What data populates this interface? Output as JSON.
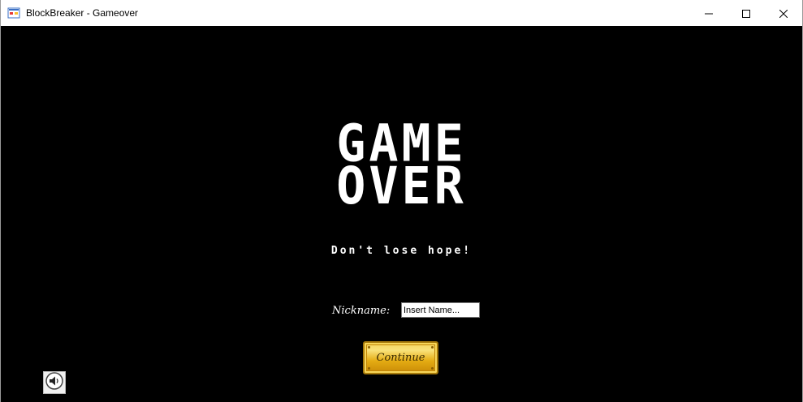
{
  "window": {
    "title": "BlockBreaker - Gameover",
    "icon": "app-icon",
    "controls": {
      "minimize_icon": "minimize-icon",
      "maximize_icon": "maximize-icon",
      "close_icon": "close-icon"
    }
  },
  "screen": {
    "heading_line1": "GAME",
    "heading_line2": "OVER",
    "subtitle": "Don't lose hope!",
    "nickname_label": "Nickname:",
    "nickname_value": "Insert Name...",
    "continue_label": "Continue",
    "sound_icon": "speaker-icon"
  },
  "colors": {
    "background": "#000000",
    "text": "#ffffff",
    "button_gold": "#e5ac13"
  }
}
